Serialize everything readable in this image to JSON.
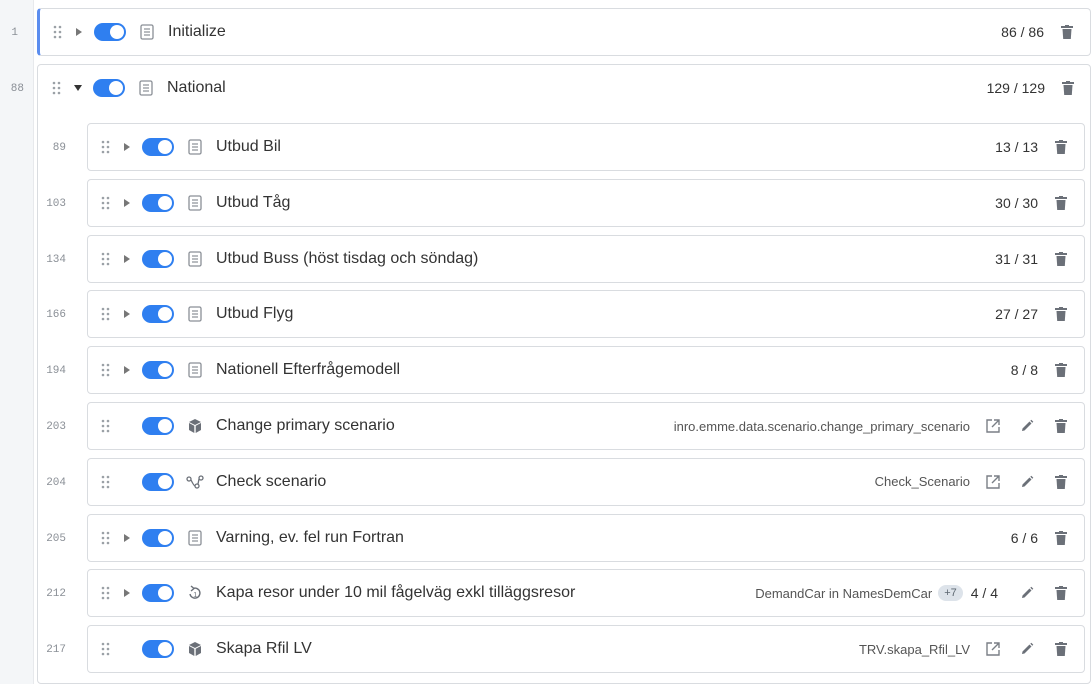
{
  "rows": [
    {
      "line": "1",
      "label": "Initialize",
      "count": "86 / 86",
      "type": "doc-icon",
      "expandable": true,
      "expanded": false
    },
    {
      "line": "88",
      "label": "National",
      "count": "129 / 129",
      "type": "doc-icon",
      "expandable": true,
      "expanded": true
    },
    {
      "line": "89",
      "label": "Utbud Bil",
      "count": "13 / 13",
      "type": "doc-icon",
      "expandable": true
    },
    {
      "line": "103",
      "label": "Utbud Tåg",
      "count": "30 / 30",
      "type": "doc-icon",
      "expandable": true
    },
    {
      "line": "134",
      "label": "Utbud Buss (höst tisdag och söndag)",
      "count": "31 / 31",
      "type": "doc-icon",
      "expandable": true
    },
    {
      "line": "166",
      "label": "Utbud Flyg",
      "count": "27 / 27",
      "type": "doc-icon",
      "expandable": true
    },
    {
      "line": "194",
      "label": "Nationell Efterfrågemodell",
      "count": "8 / 8",
      "type": "doc-icon",
      "expandable": true
    },
    {
      "line": "203",
      "label": "Change primary scenario",
      "detail": "inro.emme.data.scenario.change_primary_scenario",
      "type": "cube-icon",
      "expandable": false
    },
    {
      "line": "204",
      "label": "Check scenario",
      "detail": "Check_Scenario",
      "type": "connector-icon",
      "expandable": false
    },
    {
      "line": "205",
      "label": "Varning, ev. fel run Fortran",
      "count": "6 / 6",
      "type": "doc-icon",
      "expandable": true
    },
    {
      "line": "212",
      "label": "Kapa resor under 10 mil fågelväg exkl tilläggsresor",
      "detail": "DemandCar in NamesDemCar",
      "badge": "+7",
      "count": "4 / 4",
      "type": "loop-icon",
      "expandable": true
    },
    {
      "line": "217",
      "label": "Skapa Rfil LV",
      "detail": "TRV.skapa_Rfil_LV",
      "type": "cube-icon",
      "expandable": false
    }
  ],
  "colors": {
    "accent": "#2f7ff0",
    "selected_border": "#5b8def"
  }
}
